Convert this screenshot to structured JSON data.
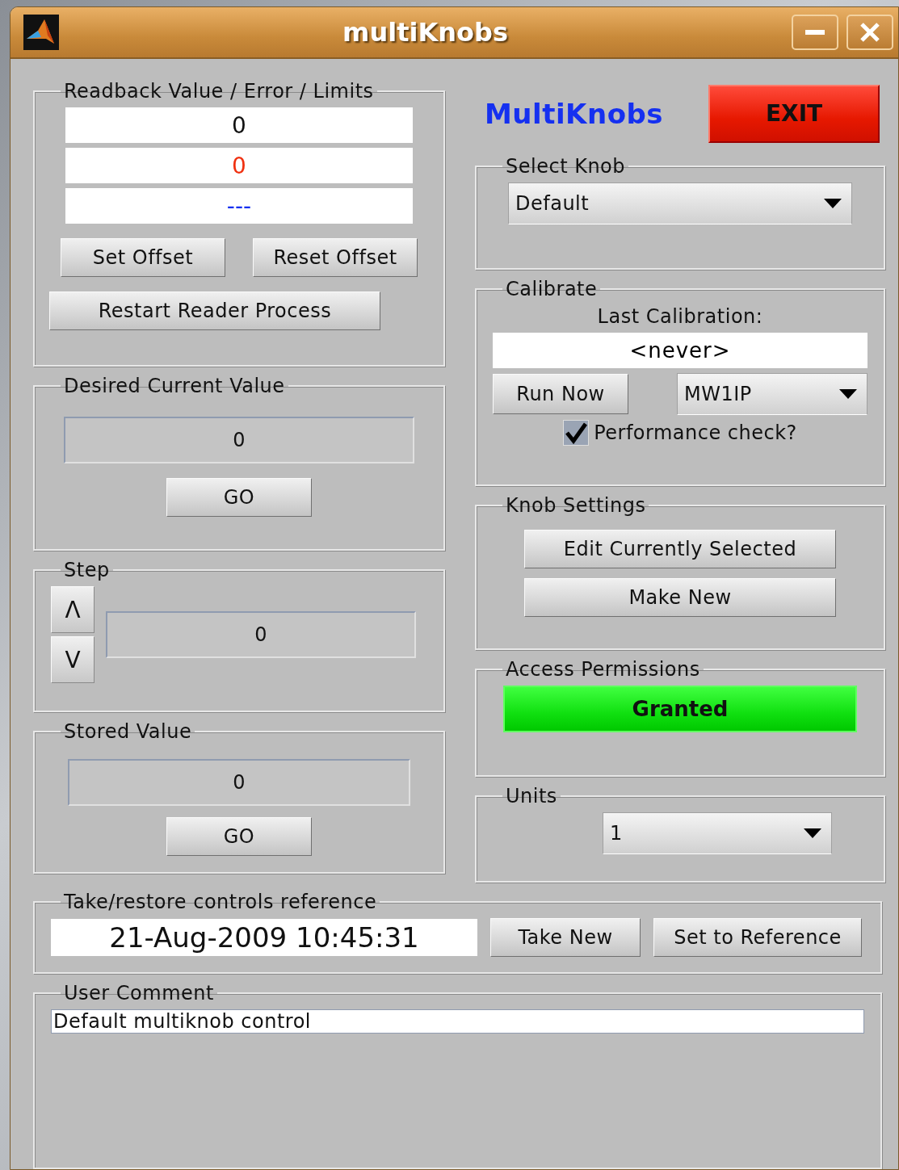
{
  "window": {
    "title": "multiKnobs"
  },
  "readback": {
    "title": "Readback Value / Error / Limits",
    "value": "0",
    "error": "0",
    "limits": "---",
    "buttons": [
      "Set Offset",
      "Reset Offset",
      "Restart Reader Process"
    ]
  },
  "desired": {
    "title": "Desired Current Value",
    "value": "0",
    "button": "GO"
  },
  "step": {
    "title": "Step",
    "up": "Λ",
    "down": "V",
    "value": "0"
  },
  "stored": {
    "title": "Stored Value",
    "value": "0",
    "button": "GO"
  },
  "header": {
    "app_name": "MultiKnobs",
    "exit_button": "EXIT"
  },
  "select_knob": {
    "title": "Select Knob",
    "value": "Default"
  },
  "calibrate": {
    "title": "Calibrate",
    "label": "Last Calibration:",
    "last": "<never>",
    "run_button": "Run Now",
    "device": "MW1IP",
    "performance_check": {
      "label": "Performance check?",
      "checked": true
    }
  },
  "knob_settings": {
    "title": "Knob Settings",
    "buttons": [
      "Edit Currently Selected",
      "Make New"
    ]
  },
  "access": {
    "title": "Access Permissions",
    "status": "Granted",
    "granted": true
  },
  "units": {
    "title": "Units",
    "value": "1"
  },
  "reference": {
    "title": "Take/restore controls reference",
    "timestamp": "21-Aug-2009 10:45:31",
    "buttons": [
      "Take New",
      "Set to Reference"
    ]
  },
  "comment": {
    "title": "User Comment",
    "text": "Default multiknob control"
  }
}
